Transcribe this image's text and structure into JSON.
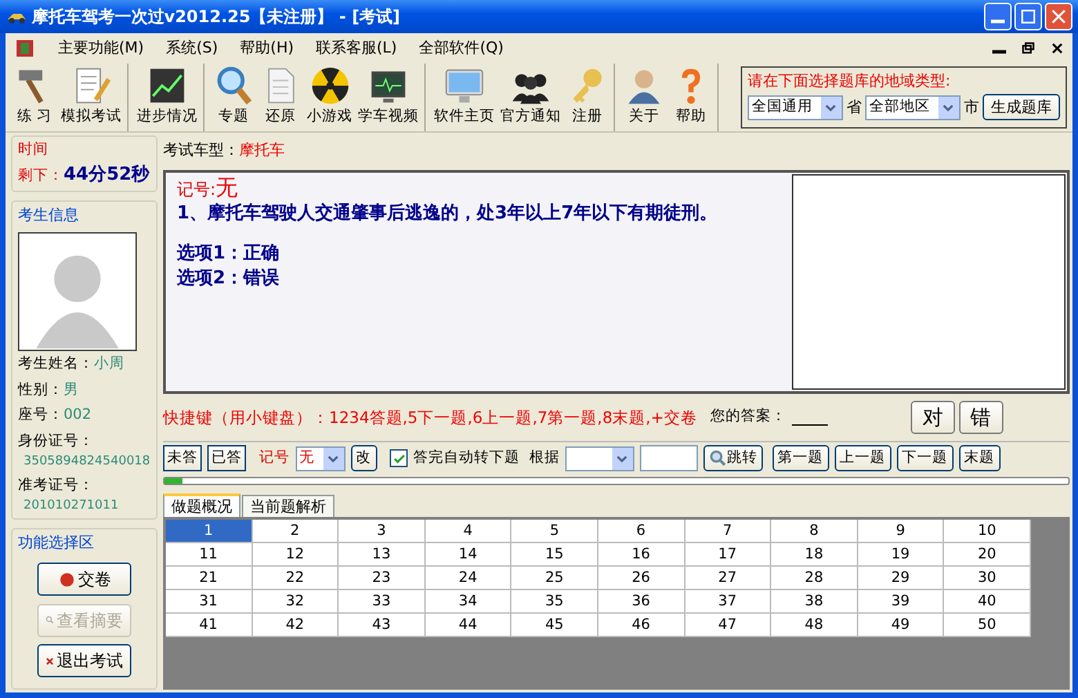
{
  "window": {
    "title": "摩托车驾考一次过v2012.25【未注册】 - [考试]"
  },
  "menu": [
    "主要功能(M)",
    "系统(S)",
    "帮助(H)",
    "联系客服(L)",
    "全部软件(Q)"
  ],
  "toolbar": {
    "groups": [
      [
        {
          "label": "练 习"
        },
        {
          "label": "模拟考试"
        }
      ],
      [
        {
          "label": "进步情况"
        }
      ],
      [
        {
          "label": "专题"
        },
        {
          "label": "还原"
        },
        {
          "label": "小游戏"
        },
        {
          "label": "学车视频"
        }
      ],
      [
        {
          "label": "软件主页"
        },
        {
          "label": "官方通知"
        },
        {
          "label": "注册"
        }
      ],
      [
        {
          "label": "关于"
        },
        {
          "label": "帮助"
        }
      ]
    ]
  },
  "region": {
    "prompt": "请在下面选择题库的地域类型:",
    "province": "全国通用",
    "province_unit": "省",
    "city": "全部地区",
    "city_unit": "市",
    "button": "生成题库"
  },
  "timer": {
    "title": "时间",
    "label": "剩下：",
    "value": "44分52秒"
  },
  "examinee": {
    "title": "考生信息",
    "fields": [
      {
        "label": "考生姓名：",
        "value": "小周"
      },
      {
        "label": "性别：",
        "value": "男"
      },
      {
        "label": "座号：",
        "value": "002"
      },
      {
        "label": "身份证号：",
        "value": "3505894824540018"
      },
      {
        "label": "准考证号：",
        "value": "201010271011"
      }
    ]
  },
  "functions": {
    "title": "功能选择区",
    "buttons": [
      {
        "label": "交卷",
        "disabled": false
      },
      {
        "label": "查看摘要",
        "disabled": true
      },
      {
        "label": "退出考试",
        "disabled": false
      }
    ]
  },
  "vehicle": {
    "label": "考试车型：",
    "value": "摩托车"
  },
  "question": {
    "mark_label": "记号:",
    "mark_value": "无",
    "text": "1、摩托车驾驶人交通肇事后逃逸的，处3年以上7年以下有期徒刑。",
    "options": [
      "选项1：正确",
      "选项2：错误"
    ]
  },
  "shortcuts": "快捷键（用小键盘）：1234答题,5下一题,6上一题,7第一题,8末题,+交卷",
  "answer": {
    "label": "您的答案：",
    "buttons": [
      "对",
      "错"
    ]
  },
  "controls": {
    "filters": [
      "未答",
      "已答"
    ],
    "mark_label": "记号",
    "mark_value": "无",
    "change": "改",
    "auto_next": {
      "label": "答完自动转下题",
      "checked": true
    },
    "by_label": "根据",
    "jump": "跳转",
    "nav": [
      "第一题",
      "上一题",
      "下一题",
      "末题"
    ]
  },
  "progress": {
    "level": 0.02
  },
  "tabs": [
    {
      "label": "做题概况",
      "selected": true
    },
    {
      "label": "当前题解析",
      "selected": false
    }
  ],
  "grid": {
    "cells": [
      {
        "label": "1",
        "selected": true
      },
      {
        "label": "2",
        "selected": false
      },
      {
        "label": "3",
        "selected": false
      },
      {
        "label": "4",
        "selected": false
      },
      {
        "label": "5",
        "selected": false
      },
      {
        "label": "6",
        "selected": false
      },
      {
        "label": "7",
        "selected": false
      },
      {
        "label": "8",
        "selected": false
      },
      {
        "label": "9",
        "selected": false
      },
      {
        "label": "10",
        "selected": false
      },
      {
        "label": "11",
        "selected": false
      },
      {
        "label": "12",
        "selected": false
      },
      {
        "label": "13",
        "selected": false
      },
      {
        "label": "14",
        "selected": false
      },
      {
        "label": "15",
        "selected": false
      },
      {
        "label": "16",
        "selected": false
      },
      {
        "label": "17",
        "selected": false
      },
      {
        "label": "18",
        "selected": false
      },
      {
        "label": "19",
        "selected": false
      },
      {
        "label": "20",
        "selected": false
      },
      {
        "label": "21",
        "selected": false
      },
      {
        "label": "22",
        "selected": false
      },
      {
        "label": "23",
        "selected": false
      },
      {
        "label": "24",
        "selected": false
      },
      {
        "label": "25",
        "selected": false
      },
      {
        "label": "26",
        "selected": false
      },
      {
        "label": "27",
        "selected": false
      },
      {
        "label": "28",
        "selected": false
      },
      {
        "label": "29",
        "selected": false
      },
      {
        "label": "30",
        "selected": false
      },
      {
        "label": "31",
        "selected": false
      },
      {
        "label": "32",
        "selected": false
      },
      {
        "label": "33",
        "selected": false
      },
      {
        "label": "34",
        "selected": false
      },
      {
        "label": "35",
        "selected": false
      },
      {
        "label": "36",
        "selected": false
      },
      {
        "label": "37",
        "selected": false
      },
      {
        "label": "38",
        "selected": false
      },
      {
        "label": "39",
        "selected": false
      },
      {
        "label": "40",
        "selected": false
      },
      {
        "label": "41",
        "selected": false
      },
      {
        "label": "42",
        "selected": false
      },
      {
        "label": "43",
        "selected": false
      },
      {
        "label": "44",
        "selected": false
      },
      {
        "label": "45",
        "selected": false
      },
      {
        "label": "46",
        "selected": false
      },
      {
        "label": "47",
        "selected": false
      },
      {
        "label": "48",
        "selected": false
      },
      {
        "label": "49",
        "selected": false
      },
      {
        "label": "50",
        "selected": false
      }
    ]
  }
}
